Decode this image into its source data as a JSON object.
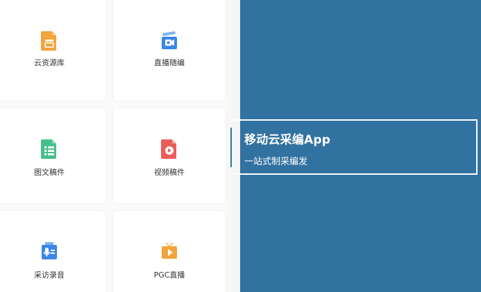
{
  "apps": [
    {
      "label": "云资源库",
      "icon": "document-stack-icon",
      "color": "#f3a43a"
    },
    {
      "label": "直播随编",
      "icon": "camera-clapper-icon",
      "color": "#3b86e8"
    },
    {
      "label": "图文稿件",
      "icon": "list-document-icon",
      "color": "#45c08d"
    },
    {
      "label": "视频稿件",
      "icon": "video-document-icon",
      "color": "#ea5e5a"
    },
    {
      "label": "采访录音",
      "icon": "microphone-doc-icon",
      "color": "#3b86e8"
    },
    {
      "label": "PGC直播",
      "icon": "tv-play-icon",
      "color": "#f3a43a"
    }
  ],
  "brand": {
    "title": "移动云采编App",
    "subtitle": "一站式制采编发",
    "background": "#3272a1"
  }
}
